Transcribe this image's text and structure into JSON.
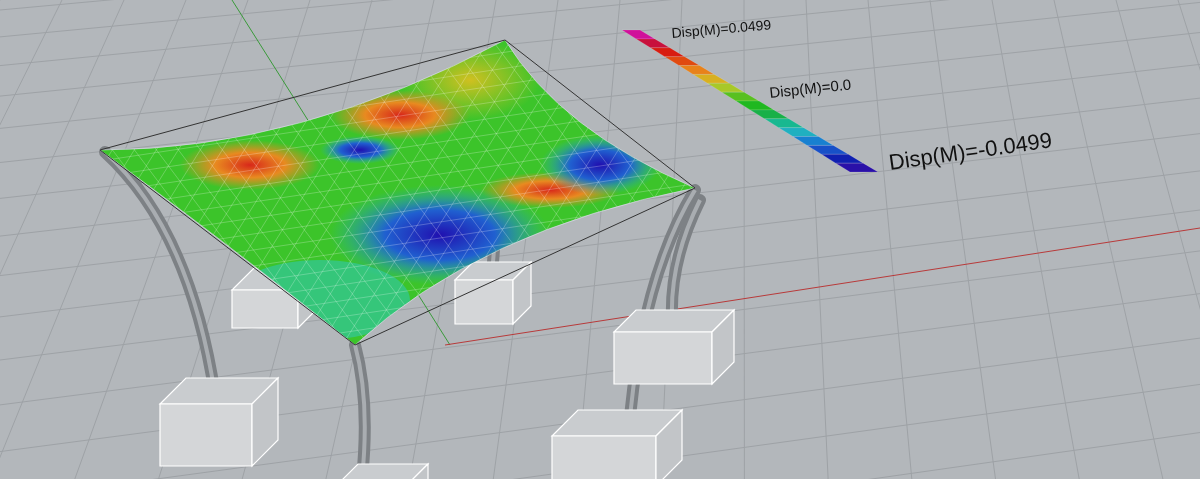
{
  "legend": {
    "labels": [
      {
        "kind": "max",
        "text": "Disp(M)=0.0499"
      },
      {
        "kind": "zero",
        "text": "Disp(M)=0.0"
      },
      {
        "kind": "min",
        "text": "Disp(M)=-0.0499"
      }
    ]
  }
}
